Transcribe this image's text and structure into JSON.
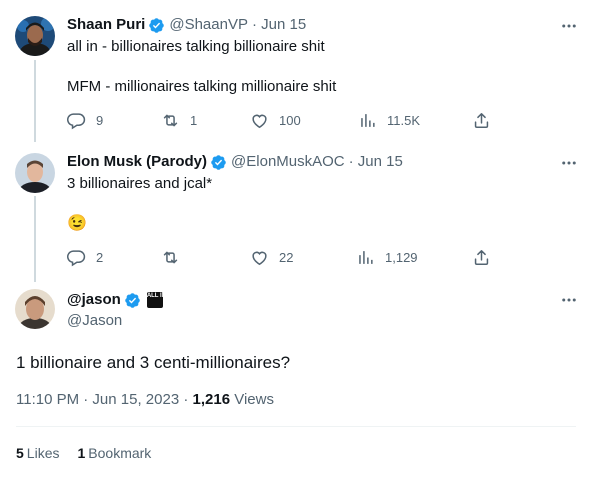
{
  "reply1": {
    "name": "Shaan Puri",
    "handle": "@ShaanVP",
    "date": "· Jun 15",
    "line1": "all in - billionaires talking billionaire shit",
    "line2": "MFM - millionaires talking millionaire shit",
    "replies": "9",
    "retweets": "1",
    "likes": "100",
    "views": "11.5K"
  },
  "reply2": {
    "name": "Elon Musk (Parody)",
    "handle": "@ElonMuskAOC",
    "date": "· Jun 15",
    "line1": "3 billionaires and jcal*",
    "emoji": "😉",
    "replies": "2",
    "retweets": "",
    "likes": "22",
    "views": "1,129"
  },
  "main": {
    "name": "@jason",
    "affiliate_badge": "ALL IN",
    "handle": "@Jason",
    "text": "1 billionaire and 3 centi-millionaires?",
    "timestamp": "11:10 PM · Jun 15, 2023 · ",
    "views_count": "1,216",
    "views_label": " Views",
    "likes_count": "5",
    "likes_label": "Likes",
    "bookmarks_count": "1",
    "bookmarks_label": "Bookmark"
  },
  "colors": {
    "verified": "#1d9bf0",
    "secondary_text": "#536471",
    "primary_text": "#0f1419",
    "thread_line": "#cfd9de"
  }
}
